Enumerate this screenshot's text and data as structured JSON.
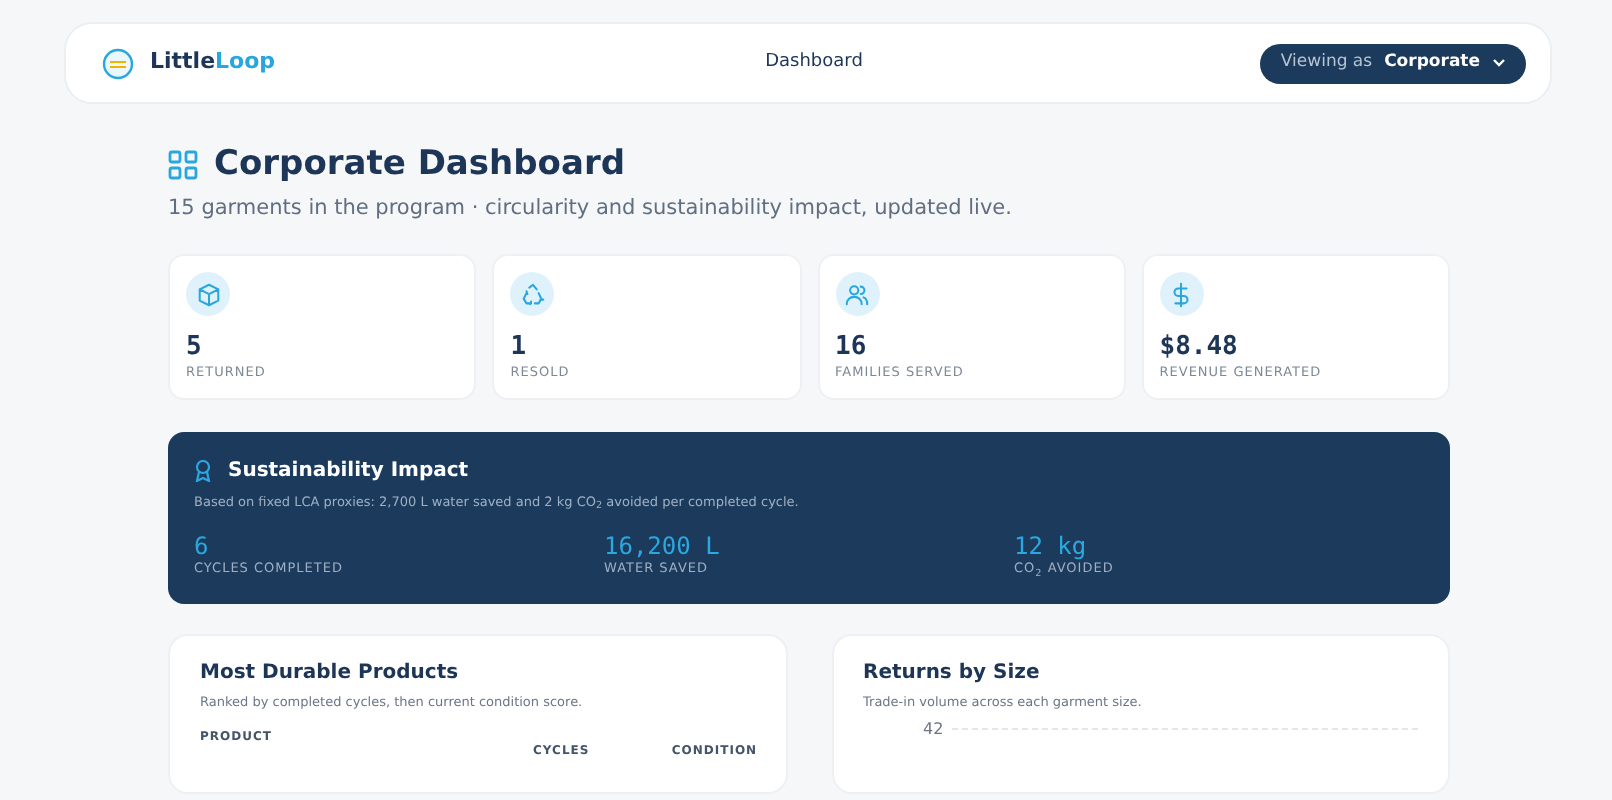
{
  "navbar": {
    "brand_start": "Little",
    "brand_end": "Loop",
    "nav_link": "Dashboard",
    "viewing_label": "Viewing as",
    "viewing_value": "Corporate"
  },
  "header": {
    "title": "Corporate Dashboard",
    "subtitle": "15 garments in the program · circularity and sustainability impact, updated live."
  },
  "stats": [
    {
      "kind": "box",
      "value": "5",
      "label": "RETURNED"
    },
    {
      "kind": "recycle",
      "value": "1",
      "label": "RESOLD"
    },
    {
      "kind": "people",
      "value": "16",
      "label": "FAMILIES SERVED"
    },
    {
      "kind": "dollar",
      "value": "$8.48",
      "label": "REVENUE GENERATED"
    }
  ],
  "impact": {
    "title": "Sustainability Impact",
    "note": "Based on fixed LCA proxies: 2,700 L water saved and 2 kg CO$_{2}$ avoided per completed cycle.",
    "metrics": [
      {
        "value": "6",
        "label": "CYCLES COMPLETED"
      },
      {
        "value": "16,200 L",
        "label": "WATER SAVED"
      },
      {
        "value": "12 kg",
        "label": "CO$_{2}$ AVOIDED"
      }
    ]
  },
  "durable": {
    "title": "Most Durable Products",
    "subtitle": "Ranked by completed cycles, then current condition score.",
    "columns": [
      "PRODUCT",
      "CYCLES",
      "CONDITION"
    ]
  },
  "returns": {
    "title": "Returns by Size",
    "subtitle": "Trade-in volume across each garment size.",
    "tick": "42"
  }
}
